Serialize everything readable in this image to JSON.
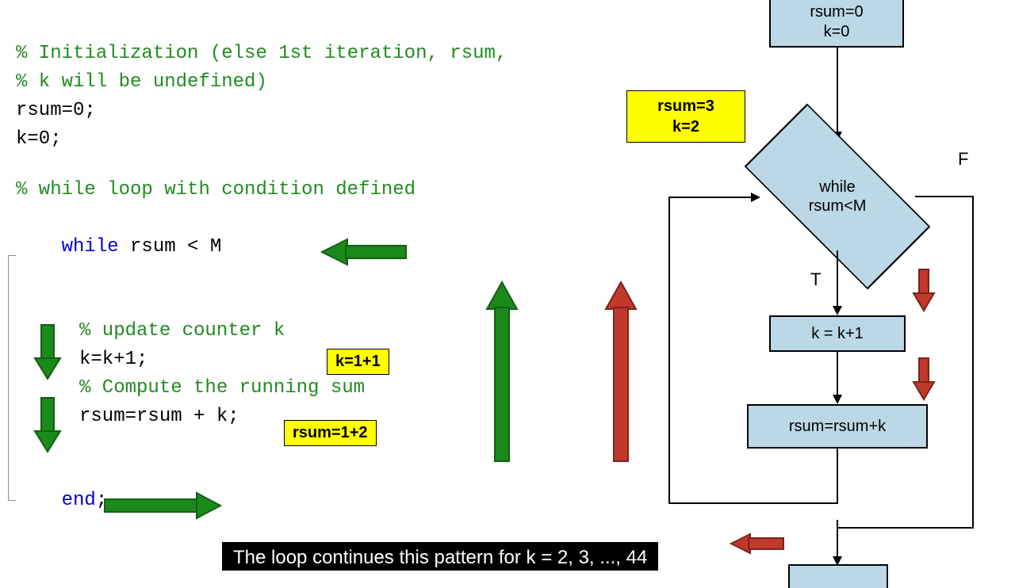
{
  "code": {
    "comment1a": "% Initialization (else 1st iteration, rsum,",
    "comment1b": "% k will be undefined)",
    "init1": "rsum=0;",
    "init2": "k=0;",
    "comment2": "% while loop with condition defined",
    "while_kw": "while",
    "while_cond": " rsum < M",
    "comment3": "% update counter k",
    "body1": "k=k+1;",
    "comment4": "% Compute the running sum",
    "body2": "rsum=rsum + k;",
    "end_kw": "end",
    "semicolon": ";"
  },
  "highlights": {
    "state": {
      "line1": "rsum=3",
      "line2": "k=2"
    },
    "k_calc": "k=1+1",
    "rsum_calc": "rsum=1+2"
  },
  "flow": {
    "init1": "rsum=0",
    "init2": "k=0",
    "cond1": "while",
    "cond2": "rsum<M",
    "true": "T",
    "false": "F",
    "step1": "k = k+1",
    "step2": "rsum=rsum+k"
  },
  "caption": "The loop continues this pattern for k = 2, 3, ..., 44",
  "colors": {
    "comment": "#228B22",
    "keyword": "#0000cd",
    "highlight": "#ffff00",
    "box_fill": "#bcd8e6",
    "arrow_green": "#1a8a1a",
    "arrow_red": "#c0392b"
  }
}
